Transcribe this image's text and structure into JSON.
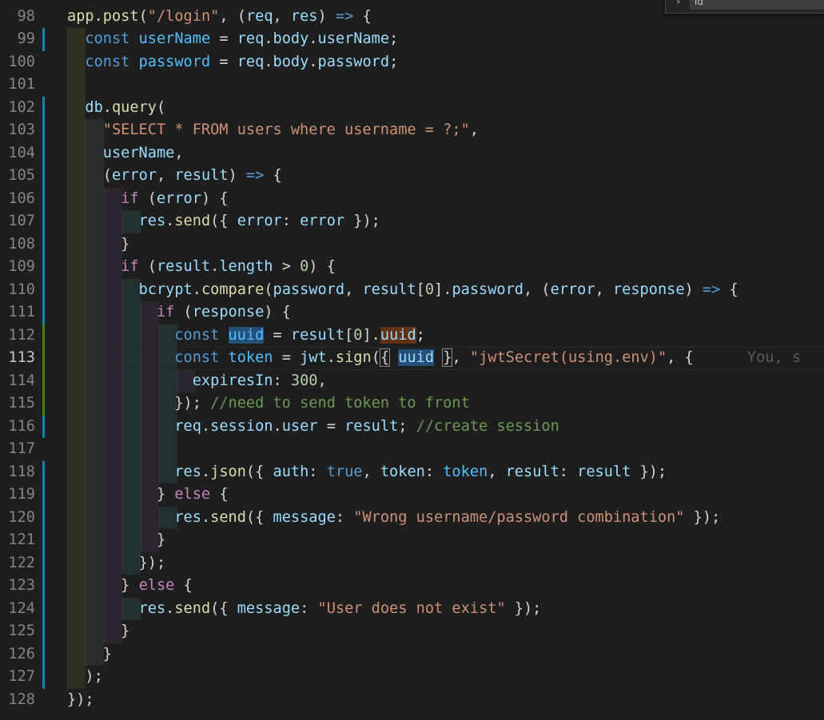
{
  "editor": {
    "active_line": 113,
    "blame_text": "You, s",
    "lines": [
      {
        "n": 98,
        "git": "",
        "guides": [],
        "tokens": [
          [
            "fn",
            "app"
          ],
          [
            "pun",
            "."
          ],
          [
            "fn",
            "post"
          ],
          [
            "pun",
            "("
          ],
          [
            "str",
            "\"/login\""
          ],
          [
            "pun",
            ", ("
          ],
          [
            "var",
            "req"
          ],
          [
            "pun",
            ", "
          ],
          [
            "var",
            "res"
          ],
          [
            "pun",
            ") "
          ],
          [
            "kw",
            "=>"
          ],
          [
            "pun",
            " {"
          ]
        ]
      },
      {
        "n": 99,
        "git": "modified",
        "guides": [
          1
        ],
        "tokens": [
          [
            "ws",
            "  "
          ],
          [
            "kw",
            "const"
          ],
          [
            "pun",
            " "
          ],
          [
            "cst",
            "userName"
          ],
          [
            "pun",
            " = "
          ],
          [
            "var",
            "req"
          ],
          [
            "pun",
            "."
          ],
          [
            "var",
            "body"
          ],
          [
            "pun",
            "."
          ],
          [
            "var",
            "userName"
          ],
          [
            "pun",
            ";"
          ]
        ]
      },
      {
        "n": 100,
        "git": "",
        "guides": [
          1
        ],
        "tokens": [
          [
            "ws",
            "  "
          ],
          [
            "kw",
            "const"
          ],
          [
            "pun",
            " "
          ],
          [
            "cst",
            "password"
          ],
          [
            "pun",
            " = "
          ],
          [
            "var",
            "req"
          ],
          [
            "pun",
            "."
          ],
          [
            "var",
            "body"
          ],
          [
            "pun",
            "."
          ],
          [
            "var",
            "password"
          ],
          [
            "pun",
            ";"
          ]
        ]
      },
      {
        "n": 101,
        "git": "",
        "guides": [
          1
        ],
        "tokens": []
      },
      {
        "n": 102,
        "git": "modified",
        "guides": [
          1
        ],
        "tokens": [
          [
            "ws",
            "  "
          ],
          [
            "var",
            "db"
          ],
          [
            "pun",
            "."
          ],
          [
            "fn",
            "query"
          ],
          [
            "pun",
            "("
          ]
        ]
      },
      {
        "n": 103,
        "git": "modified",
        "guides": [
          1,
          2
        ],
        "tokens": [
          [
            "ws",
            "    "
          ],
          [
            "str",
            "\"SELECT * FROM users where username = ?;\""
          ],
          [
            "pun",
            ","
          ]
        ]
      },
      {
        "n": 104,
        "git": "modified",
        "guides": [
          1,
          2
        ],
        "tokens": [
          [
            "ws",
            "    "
          ],
          [
            "var",
            "userName"
          ],
          [
            "pun",
            ","
          ]
        ]
      },
      {
        "n": 105,
        "git": "modified",
        "guides": [
          1,
          2
        ],
        "tokens": [
          [
            "ws",
            "    "
          ],
          [
            "pun",
            "("
          ],
          [
            "var",
            "error"
          ],
          [
            "pun",
            ", "
          ],
          [
            "var",
            "result"
          ],
          [
            "pun",
            ") "
          ],
          [
            "kw",
            "=>"
          ],
          [
            "pun",
            " {"
          ]
        ]
      },
      {
        "n": 106,
        "git": "modified",
        "guides": [
          1,
          2,
          3
        ],
        "tokens": [
          [
            "ws",
            "      "
          ],
          [
            "ctl",
            "if"
          ],
          [
            "pun",
            " ("
          ],
          [
            "var",
            "error"
          ],
          [
            "pun",
            ") {"
          ]
        ]
      },
      {
        "n": 107,
        "git": "modified",
        "guides": [
          1,
          2,
          3,
          4
        ],
        "tokens": [
          [
            "ws",
            "        "
          ],
          [
            "var",
            "res"
          ],
          [
            "pun",
            "."
          ],
          [
            "fn",
            "send"
          ],
          [
            "pun",
            "({ "
          ],
          [
            "var",
            "error"
          ],
          [
            "pun",
            ": "
          ],
          [
            "var",
            "error"
          ],
          [
            "pun",
            " });"
          ]
        ]
      },
      {
        "n": 108,
        "git": "modified",
        "guides": [
          1,
          2,
          3
        ],
        "tokens": [
          [
            "ws",
            "      "
          ],
          [
            "pun",
            "}"
          ]
        ]
      },
      {
        "n": 109,
        "git": "modified",
        "guides": [
          1,
          2,
          3
        ],
        "tokens": [
          [
            "ws",
            "      "
          ],
          [
            "ctl",
            "if"
          ],
          [
            "pun",
            " ("
          ],
          [
            "var",
            "result"
          ],
          [
            "pun",
            "."
          ],
          [
            "var",
            "length"
          ],
          [
            "pun",
            " > "
          ],
          [
            "num",
            "0"
          ],
          [
            "pun",
            ") {"
          ]
        ]
      },
      {
        "n": 110,
        "git": "modified",
        "guides": [
          1,
          2,
          3,
          4
        ],
        "tokens": [
          [
            "ws",
            "        "
          ],
          [
            "var",
            "bcrypt"
          ],
          [
            "pun",
            "."
          ],
          [
            "fn",
            "compare"
          ],
          [
            "pun",
            "("
          ],
          [
            "var",
            "password"
          ],
          [
            "pun",
            ", "
          ],
          [
            "var",
            "result"
          ],
          [
            "pun",
            "["
          ],
          [
            "num",
            "0"
          ],
          [
            "pun",
            "]."
          ],
          [
            "var",
            "password"
          ],
          [
            "pun",
            ", ("
          ],
          [
            "var",
            "error"
          ],
          [
            "pun",
            ", "
          ],
          [
            "var",
            "response"
          ],
          [
            "pun",
            ") "
          ],
          [
            "kw",
            "=>"
          ],
          [
            "pun",
            " {"
          ]
        ]
      },
      {
        "n": 111,
        "git": "modified",
        "guides": [
          1,
          2,
          3,
          4,
          5
        ],
        "tokens": [
          [
            "ws",
            "          "
          ],
          [
            "ctl",
            "if"
          ],
          [
            "pun",
            " ("
          ],
          [
            "var",
            "response"
          ],
          [
            "pun",
            ") {"
          ]
        ]
      },
      {
        "n": 112,
        "git": "added",
        "guides": [
          1,
          2,
          3,
          4,
          5,
          6
        ],
        "tokens": [
          [
            "ws",
            "            "
          ],
          [
            "kw",
            "const"
          ],
          [
            "pun",
            " "
          ],
          [
            "cst hl-blue",
            "uuid"
          ],
          [
            "pun",
            " = "
          ],
          [
            "var",
            "result"
          ],
          [
            "pun",
            "["
          ],
          [
            "num",
            "0"
          ],
          [
            "pun",
            "]."
          ],
          [
            "var hl-orange",
            "uuid"
          ],
          [
            "pun",
            ";"
          ]
        ]
      },
      {
        "n": 113,
        "git": "added",
        "guides": [
          1,
          2,
          3,
          4,
          5,
          6
        ],
        "tokens": [
          [
            "ws",
            "            "
          ],
          [
            "kw",
            "const"
          ],
          [
            "pun",
            " "
          ],
          [
            "cst",
            "token"
          ],
          [
            "pun",
            " = "
          ],
          [
            "var",
            "jwt"
          ],
          [
            "pun",
            "."
          ],
          [
            "fn",
            "sign"
          ],
          [
            "pun",
            "("
          ],
          [
            "pun hl-box",
            "{"
          ],
          [
            "pun",
            " "
          ],
          [
            "var hl-blue",
            "uuid"
          ],
          [
            "pun",
            " "
          ],
          [
            "pun hl-box",
            "}"
          ],
          [
            "pun",
            ", "
          ],
          [
            "str",
            "\"jwtSecret(using.env)\""
          ],
          [
            "pun",
            ", {"
          ],
          [
            "blame",
            "      You, s"
          ]
        ]
      },
      {
        "n": 114,
        "git": "added",
        "guides": [
          1,
          2,
          3,
          4,
          5,
          6,
          7
        ],
        "tokens": [
          [
            "ws",
            "              "
          ],
          [
            "var",
            "expiresIn"
          ],
          [
            "pun",
            ": "
          ],
          [
            "num",
            "300"
          ],
          [
            "pun",
            ","
          ]
        ]
      },
      {
        "n": 115,
        "git": "added",
        "guides": [
          1,
          2,
          3,
          4,
          5,
          6
        ],
        "tokens": [
          [
            "ws",
            "            "
          ],
          [
            "pun",
            "}); "
          ],
          [
            "cmt",
            "//need to send token to front"
          ]
        ]
      },
      {
        "n": 116,
        "git": "modified",
        "guides": [
          1,
          2,
          3,
          4,
          5,
          6
        ],
        "tokens": [
          [
            "ws",
            "            "
          ],
          [
            "var",
            "req"
          ],
          [
            "pun",
            "."
          ],
          [
            "var",
            "session"
          ],
          [
            "pun",
            "."
          ],
          [
            "var",
            "user"
          ],
          [
            "pun",
            " = "
          ],
          [
            "var",
            "result"
          ],
          [
            "pun",
            "; "
          ],
          [
            "cmt",
            "//create session"
          ]
        ]
      },
      {
        "n": 117,
        "git": "",
        "guides": [
          1,
          2,
          3,
          4,
          5,
          6
        ],
        "tokens": []
      },
      {
        "n": 118,
        "git": "modified",
        "guides": [
          1,
          2,
          3,
          4,
          5,
          6
        ],
        "tokens": [
          [
            "ws",
            "            "
          ],
          [
            "var",
            "res"
          ],
          [
            "pun",
            "."
          ],
          [
            "fn",
            "json"
          ],
          [
            "pun",
            "({ "
          ],
          [
            "var",
            "auth"
          ],
          [
            "pun",
            ": "
          ],
          [
            "kw",
            "true"
          ],
          [
            "pun",
            ", "
          ],
          [
            "var",
            "token"
          ],
          [
            "pun",
            ": "
          ],
          [
            "cst",
            "token"
          ],
          [
            "pun",
            ", "
          ],
          [
            "var",
            "result"
          ],
          [
            "pun",
            ": "
          ],
          [
            "var",
            "result"
          ],
          [
            "pun",
            " });"
          ]
        ]
      },
      {
        "n": 119,
        "git": "modified",
        "guides": [
          1,
          2,
          3,
          4,
          5
        ],
        "tokens": [
          [
            "ws",
            "          "
          ],
          [
            "pun",
            "} "
          ],
          [
            "ctl",
            "else"
          ],
          [
            "pun",
            " {"
          ]
        ]
      },
      {
        "n": 120,
        "git": "modified",
        "guides": [
          1,
          2,
          3,
          4,
          5,
          6
        ],
        "tokens": [
          [
            "ws",
            "            "
          ],
          [
            "var",
            "res"
          ],
          [
            "pun",
            "."
          ],
          [
            "fn",
            "send"
          ],
          [
            "pun",
            "({ "
          ],
          [
            "var",
            "message"
          ],
          [
            "pun",
            ": "
          ],
          [
            "str",
            "\"Wrong username/password combination\""
          ],
          [
            "pun",
            " });"
          ]
        ]
      },
      {
        "n": 121,
        "git": "modified",
        "guides": [
          1,
          2,
          3,
          4,
          5
        ],
        "tokens": [
          [
            "ws",
            "          "
          ],
          [
            "pun",
            "}"
          ]
        ]
      },
      {
        "n": 122,
        "git": "modified",
        "guides": [
          1,
          2,
          3,
          4
        ],
        "tokens": [
          [
            "ws",
            "        "
          ],
          [
            "pun",
            "});"
          ]
        ]
      },
      {
        "n": 123,
        "git": "modified",
        "guides": [
          1,
          2,
          3
        ],
        "tokens": [
          [
            "ws",
            "      "
          ],
          [
            "pun",
            "} "
          ],
          [
            "ctl",
            "else"
          ],
          [
            "pun",
            " {"
          ]
        ]
      },
      {
        "n": 124,
        "git": "modified",
        "guides": [
          1,
          2,
          3,
          4
        ],
        "tokens": [
          [
            "ws",
            "        "
          ],
          [
            "var",
            "res"
          ],
          [
            "pun",
            "."
          ],
          [
            "fn",
            "send"
          ],
          [
            "pun",
            "({ "
          ],
          [
            "var",
            "message"
          ],
          [
            "pun",
            ": "
          ],
          [
            "str",
            "\"User does not exist\""
          ],
          [
            "pun",
            " });"
          ]
        ]
      },
      {
        "n": 125,
        "git": "modified",
        "guides": [
          1,
          2,
          3
        ],
        "tokens": [
          [
            "ws",
            "      "
          ],
          [
            "pun",
            "}"
          ]
        ]
      },
      {
        "n": 126,
        "git": "modified",
        "guides": [
          1,
          2
        ],
        "tokens": [
          [
            "ws",
            "    "
          ],
          [
            "pun",
            "}"
          ]
        ]
      },
      {
        "n": 127,
        "git": "modified",
        "guides": [
          1
        ],
        "tokens": [
          [
            "ws",
            "  "
          ],
          [
            "pun",
            ");"
          ]
        ]
      },
      {
        "n": 128,
        "git": "",
        "guides": [],
        "tokens": [
          [
            "pun",
            "});"
          ]
        ]
      }
    ]
  },
  "find_widget": {
    "chevron_icon": "chevron-right-icon",
    "value": "id"
  },
  "colors": {
    "background": "#1e1e1e",
    "keyword": "#569cd6",
    "control": "#c586c0",
    "function": "#dcdcaa",
    "variable": "#9cdcfe",
    "constant": "#4fc1ff",
    "string": "#ce9178",
    "number": "#b5cea8",
    "comment": "#6a9955",
    "git_modified": "#1b81a8",
    "git_added": "#487e02"
  }
}
